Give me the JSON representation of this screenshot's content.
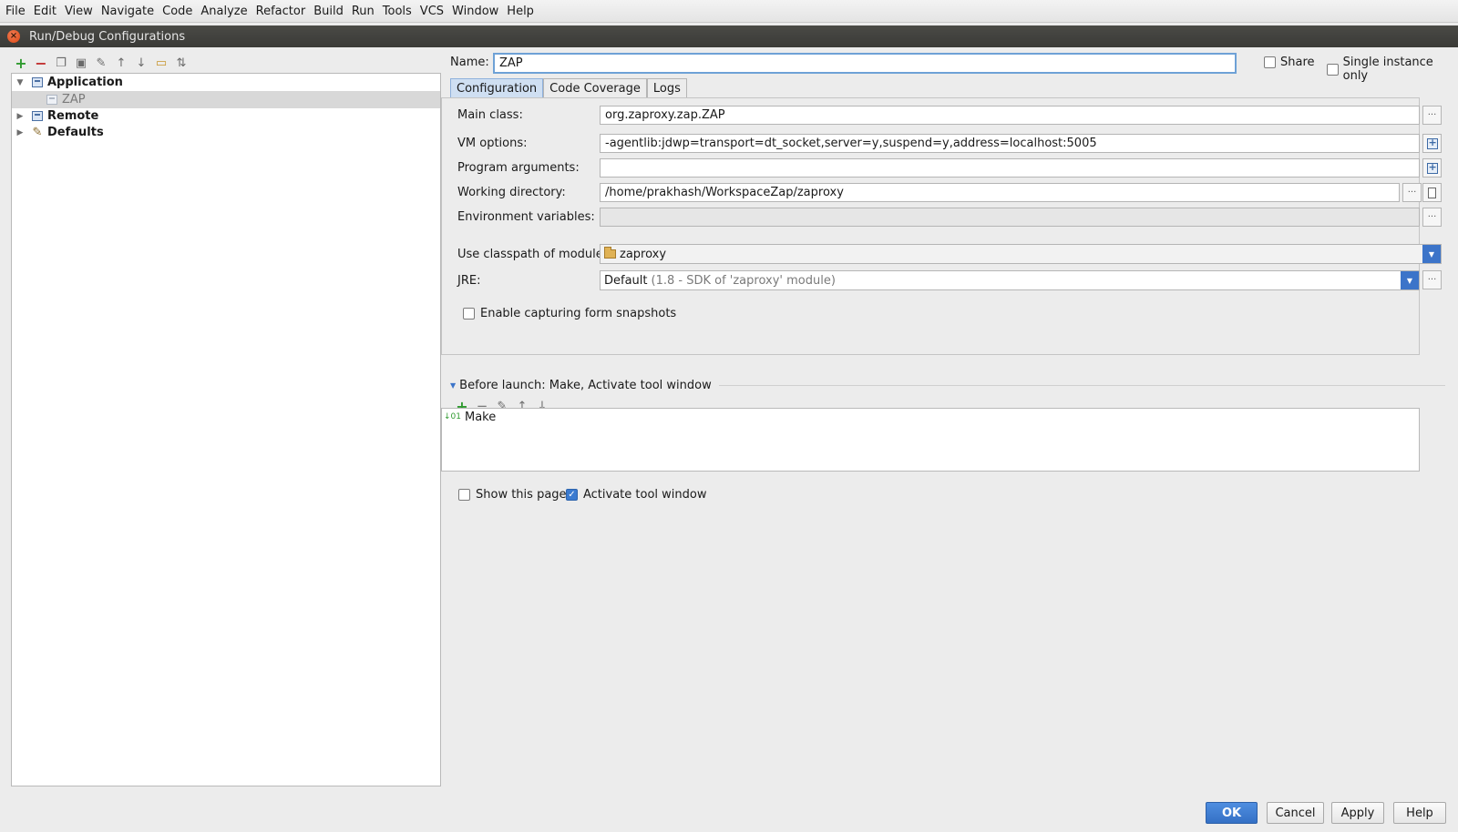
{
  "menu": [
    "File",
    "Edit",
    "View",
    "Navigate",
    "Code",
    "Analyze",
    "Refactor",
    "Build",
    "Run",
    "Tools",
    "VCS",
    "Window",
    "Help"
  ],
  "dialog": {
    "title": "Run/Debug Configurations"
  },
  "tree": {
    "application": "Application",
    "zap": "ZAP",
    "remote": "Remote",
    "defaults": "Defaults"
  },
  "form": {
    "name_label": "Name:",
    "name_value": "ZAP",
    "share_label": "Share",
    "single_instance_label": "Single instance only",
    "tabs": [
      "Configuration",
      "Code Coverage",
      "Logs"
    ],
    "main_class_label": "Main class:",
    "main_class_value": "org.zaproxy.zap.ZAP",
    "vm_options_label": "VM options:",
    "vm_options_value": "-agentlib:jdwp=transport=dt_socket,server=y,suspend=y,address=localhost:5005",
    "program_args_label": "Program arguments:",
    "program_args_value": "",
    "working_dir_label": "Working directory:",
    "working_dir_value": "/home/prakhash/WorkspaceZap/zaproxy",
    "env_vars_label": "Environment variables:",
    "env_vars_value": "",
    "classpath_label": "Use classpath of module:",
    "classpath_value": "zaproxy",
    "jre_label": "JRE:",
    "jre_value": "Default",
    "jre_detail": "(1.8 - SDK of 'zaproxy' module)",
    "snapshots_label": "Enable capturing form snapshots"
  },
  "before_launch": {
    "header": "Before launch: Make, Activate tool window",
    "items": [
      "Make"
    ],
    "show_page_label": "Show this page",
    "activate_window_label": "Activate tool window"
  },
  "buttons": {
    "ok": "OK",
    "cancel": "Cancel",
    "apply": "Apply",
    "help": "Help"
  },
  "colors": {
    "accent": "#3c74c9",
    "title_bar": "#3c3b37",
    "close": "#dd4814"
  }
}
